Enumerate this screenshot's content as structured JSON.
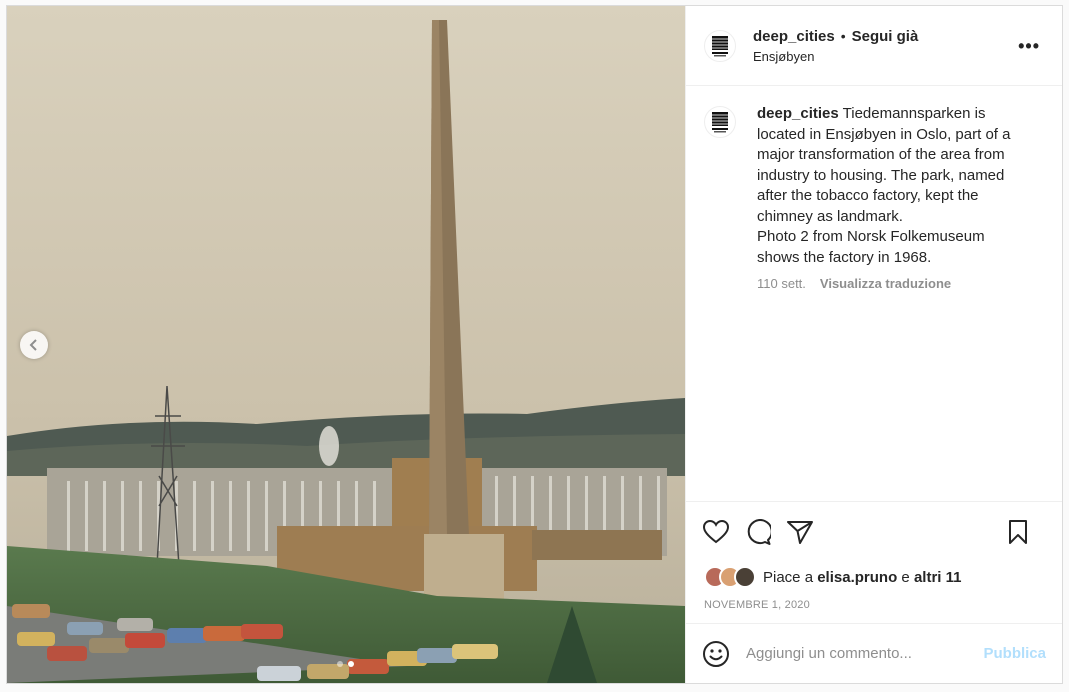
{
  "post": {
    "username": "deep_cities",
    "bullet": "•",
    "follow_label": "Segui già",
    "location": "Ensjøbyen",
    "more_label": "•••",
    "avatar_lines": [
      "DEEP",
      "CITIES"
    ]
  },
  "caption": {
    "username": "deep_cities",
    "text": "Tiedemannsparken is located in Ensjøbyen in Oslo, part of a major transformation of the area from industry to housing. The park, named after the tobacco factory, kept the chimney as landmark.",
    "text2": "Photo 2 from Norsk Folkemuseum shows the factory in 1968.",
    "age": "110 sett.",
    "translate_label": "Visualizza traduzione"
  },
  "actions": {
    "like_icon": "heart-icon",
    "comment_icon": "comment-icon",
    "share_icon": "paper-plane-icon",
    "save_icon": "bookmark-icon"
  },
  "likes": {
    "prefix": "Piace a",
    "user": "elisa.pruno",
    "conj": "e",
    "others": "altri 11"
  },
  "date": "NOVEMBRE 1, 2020",
  "composer": {
    "placeholder": "Aggiungi un commento...",
    "publish_label": "Pubblica"
  },
  "carousel": {
    "total": 2,
    "current": 2
  },
  "colors": {
    "link_disabled": "#b2dffc",
    "muted": "#8e8e8e",
    "text": "#262626"
  }
}
